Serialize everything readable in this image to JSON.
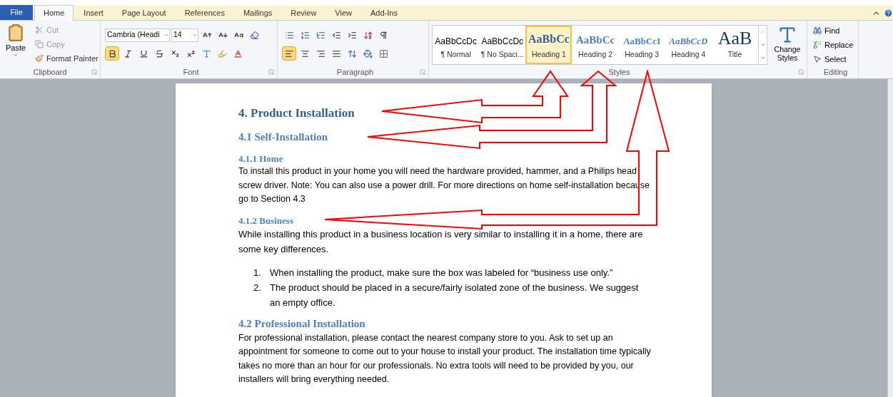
{
  "tabs": [
    {
      "label": "File",
      "kind": "file",
      "selected": false
    },
    {
      "label": "Home",
      "kind": "tab",
      "selected": true
    },
    {
      "label": "Insert",
      "kind": "tab",
      "selected": false
    },
    {
      "label": "Page Layout",
      "kind": "tab",
      "selected": false
    },
    {
      "label": "References",
      "kind": "tab",
      "selected": false
    },
    {
      "label": "Mailings",
      "kind": "tab",
      "selected": false
    },
    {
      "label": "Review",
      "kind": "tab",
      "selected": false
    },
    {
      "label": "View",
      "kind": "tab",
      "selected": false
    },
    {
      "label": "Add-Ins",
      "kind": "tab",
      "selected": false
    }
  ],
  "clipboard": {
    "label": "Clipboard",
    "paste": "Paste",
    "cut": "Cut",
    "copy": "Copy",
    "format_painter": "Format Painter"
  },
  "font": {
    "label": "Font",
    "font_name": "Cambria (Headi",
    "font_size": "14",
    "bold_on": true
  },
  "paragraph": {
    "label": "Paragraph",
    "align_left_on": true
  },
  "styles": {
    "label": "Styles",
    "items": [
      {
        "preview": "AaBbCcDc",
        "label": "¶ Normal",
        "kind": "normal",
        "selected": false
      },
      {
        "preview": "AaBbCcDc",
        "label": "¶ No Spaci...",
        "kind": "normal",
        "selected": false
      },
      {
        "preview": "AaBbCc",
        "label": "Heading 1",
        "kind": "heading1",
        "selected": true
      },
      {
        "preview": "AaBbCc",
        "label": "Heading 2",
        "kind": "heading2",
        "selected": false
      },
      {
        "preview": "AaBbCcI",
        "label": "Heading 3",
        "kind": "heading3",
        "selected": false
      },
      {
        "preview": "AaBbCcD",
        "label": "Heading 4",
        "kind": "heading4",
        "selected": false
      },
      {
        "preview": "AaB",
        "label": "Title",
        "kind": "title",
        "selected": false
      }
    ],
    "change_styles": "Change Styles"
  },
  "editing": {
    "label": "Editing",
    "find": "Find",
    "replace": "Replace",
    "select": "Select"
  },
  "document": [
    {
      "kind": "h1",
      "text": "4. Product Installation"
    },
    {
      "kind": "h2",
      "text": "4.1 Self-Installation"
    },
    {
      "kind": "h3",
      "text": "4.1.1 Home"
    },
    {
      "kind": "body",
      "text": "To install this product in your home you will need the hardware provided, hammer, and a Philips head screw driver. Note: You can also use a power drill. For more directions on home self-installation because go to Section 4.3"
    },
    {
      "kind": "h3",
      "text": "4.1.2 Business"
    },
    {
      "kind": "body_large",
      "text": "While installing this product in a business location is very similar to installing it in a home, there are some key differences."
    },
    {
      "kind": "list",
      "items": [
        {
          "number": "1.",
          "text": "When installing the product, make sure the box was labeled for “business use only.”"
        },
        {
          "number": "2.",
          "text": "The product should be placed in a secure/fairly isolated zone of the business. We suggest an empty office."
        }
      ]
    },
    {
      "kind": "h2",
      "text": "4.2 Professional Installation"
    },
    {
      "kind": "body",
      "text": "For professional installation, please contact the nearest company store to you. Ask to set up an appointment for someone to come out to your house to install your product. The installation time typically takes no more than an hour for our professionals. No extra tools will need to be provided by you, our installers will bring everything needed."
    }
  ]
}
